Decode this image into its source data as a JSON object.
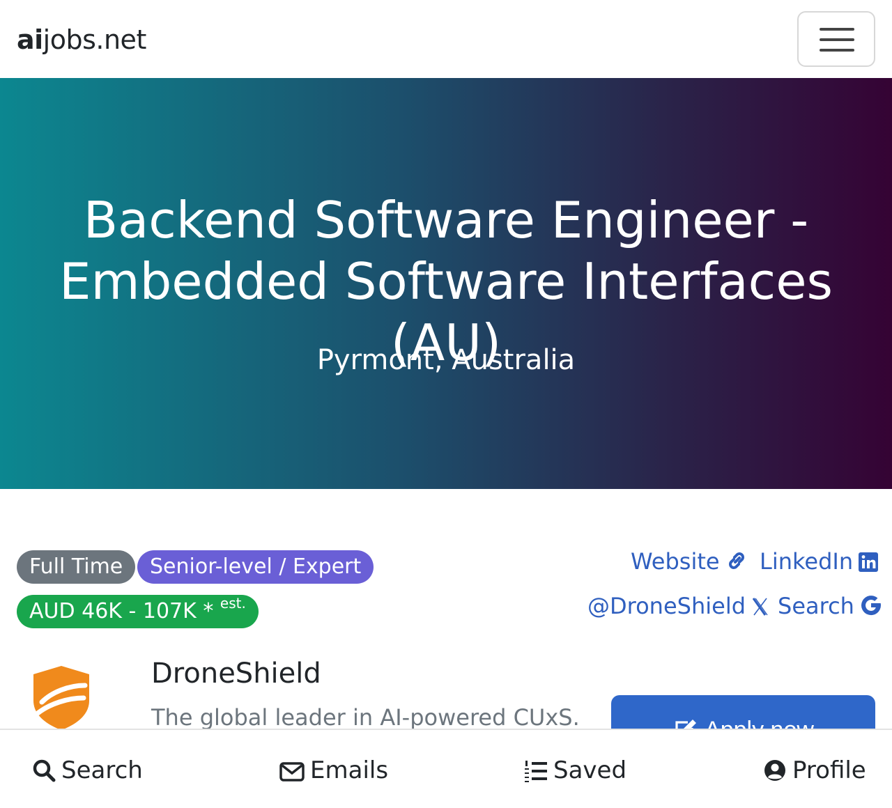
{
  "navbar": {
    "brand_bold": "ai",
    "brand_rest": "jobs.net"
  },
  "hero": {
    "title": "Backend Software Engineer - Embedded Software Interfaces (AU)",
    "location": "Pyrmont, Australia"
  },
  "badges": {
    "type": "Full Time",
    "level": "Senior-level / Expert",
    "salary": "AUD 46K - 107K *",
    "salary_note": "est."
  },
  "links": {
    "website": "Website",
    "linkedin": "LinkedIn",
    "twitter": "@DroneShield",
    "search": "Search"
  },
  "company": {
    "name": "DroneShield",
    "tagline": "The global leader in AI-powered CUxS."
  },
  "apply": {
    "label": "Apply now"
  },
  "bottom_nav": {
    "search": "Search",
    "emails": "Emails",
    "saved": "Saved",
    "profile": "Profile"
  },
  "colors": {
    "link": "#2f5fbf",
    "badge_type": "#6c757d",
    "badge_level": "#6a5fd6",
    "badge_salary": "#19a64d",
    "apply": "#2f67c9",
    "logo": "#f08a1c"
  }
}
